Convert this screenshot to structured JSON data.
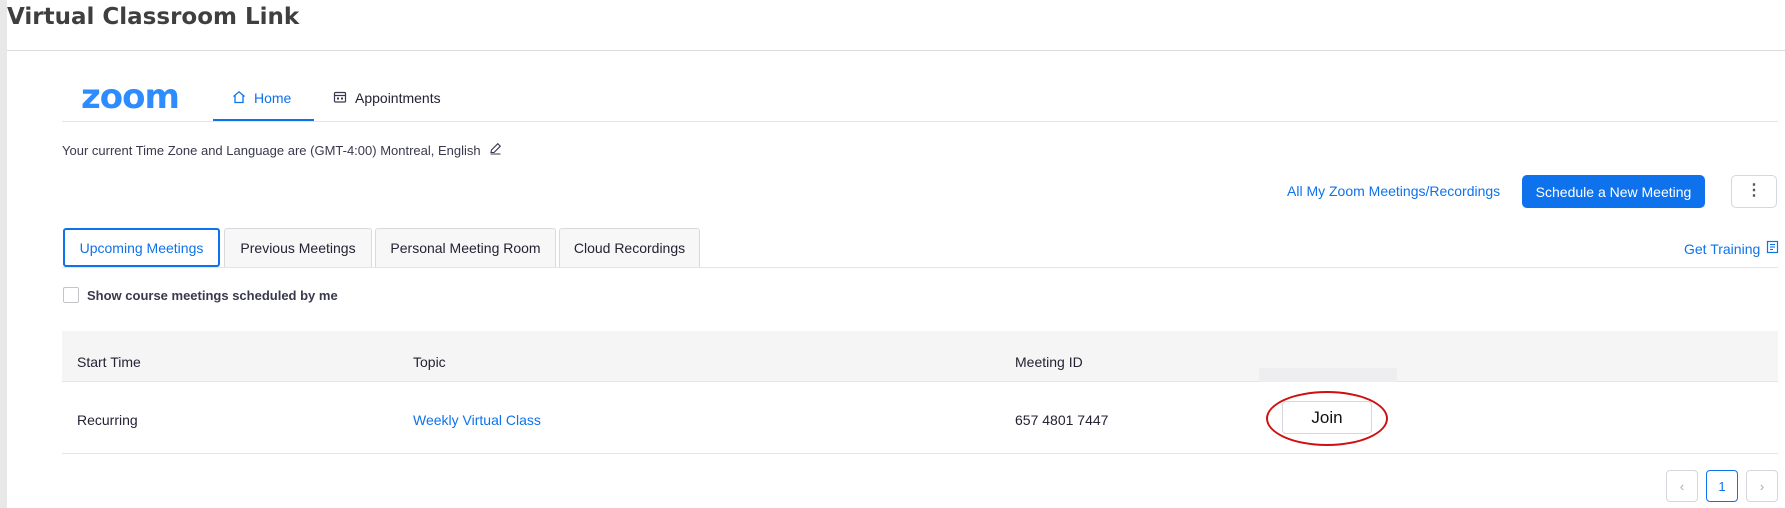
{
  "page": {
    "title": "Virtual Classroom Link"
  },
  "zoom": {
    "logo_text": "zoom",
    "nav": [
      {
        "label": "Home",
        "icon": "home-icon"
      },
      {
        "label": "Appointments",
        "icon": "calendar-icon"
      }
    ],
    "timezone_text": "Your current Time Zone and Language are (GMT-4:00) Montreal, English",
    "all_meetings_link": "All My Zoom Meetings/Recordings",
    "schedule_button": "Schedule a New Meeting",
    "more_button_icon": "more-vertical-icon",
    "tabs": [
      {
        "label": "Upcoming Meetings",
        "active": true
      },
      {
        "label": "Previous Meetings",
        "active": false
      },
      {
        "label": "Personal Meeting Room",
        "active": false
      },
      {
        "label": "Cloud Recordings",
        "active": false
      }
    ],
    "get_training": "Get Training",
    "show_course_label": "Show course meetings scheduled by me",
    "table": {
      "columns": [
        "Start Time",
        "Topic",
        "Meeting ID",
        ""
      ],
      "rows": [
        {
          "start_time": "Recurring",
          "topic": "Weekly Virtual Class",
          "meeting_id": "657 4801 7447",
          "action": "Join"
        }
      ]
    },
    "pagination": {
      "current_page": "1",
      "prev_icon": "chevron-left-icon",
      "next_icon": "chevron-right-icon"
    }
  },
  "colors": {
    "accent": "#0e72ed",
    "logo": "#2d8cff",
    "highlight_ellipse": "#d01010"
  }
}
